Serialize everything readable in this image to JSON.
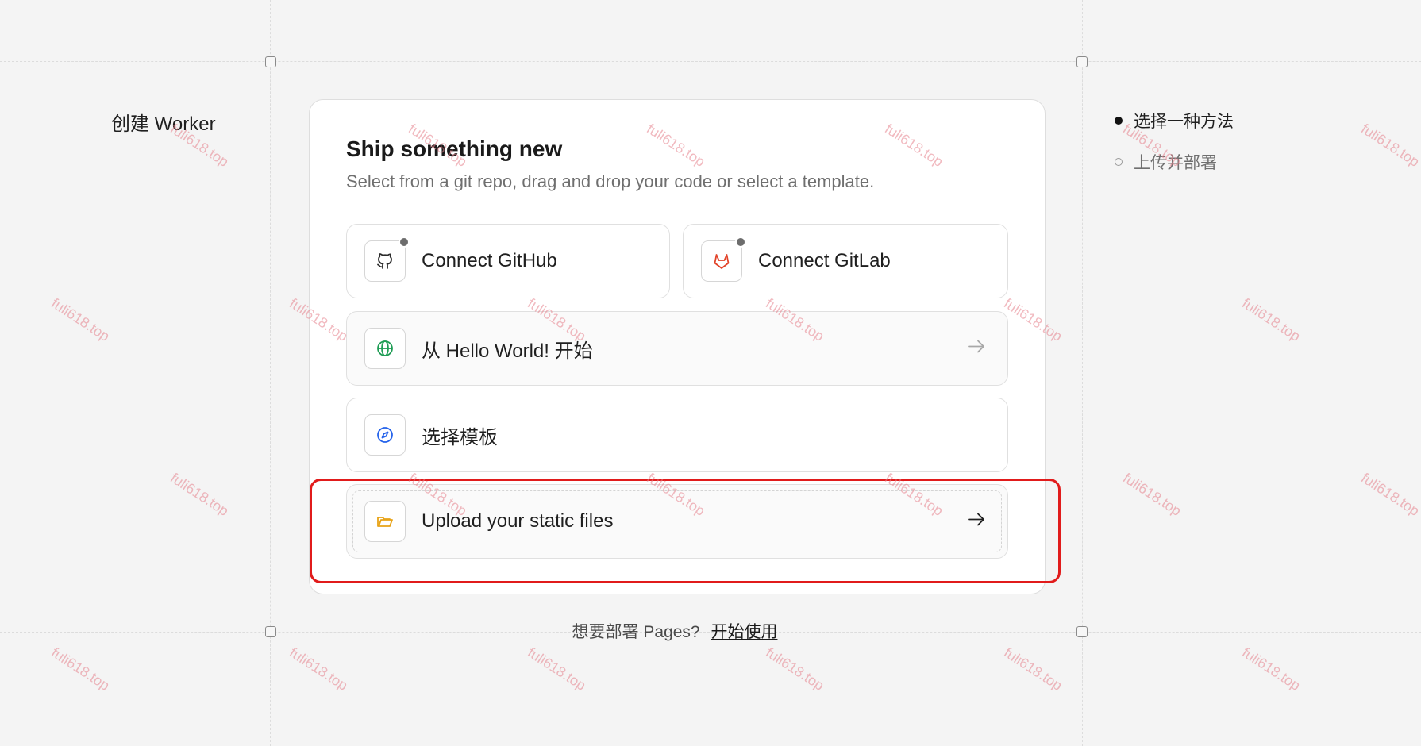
{
  "page": {
    "title": "创建 Worker"
  },
  "stepper": {
    "steps": [
      {
        "label": "选择一种方法",
        "state": "active"
      },
      {
        "label": "上传并部署",
        "state": "pending"
      }
    ]
  },
  "card": {
    "title": "Ship something new",
    "subtitle": "Select from a git repo, drag and drop your code or select a template.",
    "options": {
      "github": {
        "label": "Connect GitHub",
        "icon": "github-icon"
      },
      "gitlab": {
        "label": "Connect GitLab",
        "icon": "gitlab-icon"
      },
      "hello_world": {
        "label": "从 Hello World! 开始",
        "icon": "globe-icon"
      },
      "template": {
        "label": "选择模板",
        "icon": "compass-icon"
      },
      "upload": {
        "label": "Upload your static files",
        "icon": "folder-icon"
      }
    }
  },
  "footer": {
    "text": "想要部署 Pages?",
    "link": "开始使用"
  },
  "watermark": "fuli618.top",
  "colors": {
    "highlight": "#e11b1b",
    "globe": "#1f9d55",
    "compass": "#2563eb",
    "folder": "#e8a317",
    "gitlab": "#e24329"
  }
}
